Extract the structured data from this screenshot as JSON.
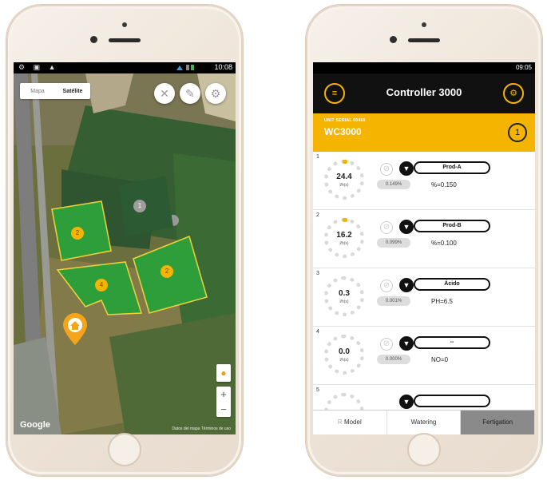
{
  "left_phone": {
    "status": {
      "icons_left": "⚙ ▣ ▲",
      "time": "10:08"
    },
    "map_toggle": {
      "map": "Mapa",
      "satellite": "Satélite"
    },
    "controls": {
      "close_icon": "close-icon",
      "edit_icon": "pencil-icon",
      "settings_icon": "gear-icon"
    },
    "fields": [
      {
        "label": "2",
        "color": "#2e9e3a"
      },
      {
        "label": "4",
        "color": "#2e9e3a"
      },
      {
        "label": "2",
        "color": "#2e9e3a"
      },
      {
        "label": "1",
        "color": "#2c5a32"
      }
    ],
    "home_marker_icon": "home-icon",
    "zoom": {
      "in": "+",
      "out": "−"
    },
    "google_label": "Google",
    "credits": "Datos del mapa   Términos de uso"
  },
  "right_phone": {
    "status": {
      "time": "09:05"
    },
    "header": {
      "title": "Controller 3000",
      "menu_icon": "menu-icon",
      "settings_icon": "gear-icon"
    },
    "unit": {
      "serial_label": "UNIT SERIAL 00466",
      "name": "WC3000",
      "number": "1"
    },
    "channels": [
      {
        "index": "1",
        "value": "24.4",
        "unit": "l/h(s)",
        "product": "Prod-A",
        "percent": "0.149%",
        "param": "%=0.150"
      },
      {
        "index": "2",
        "value": "16.2",
        "unit": "l/h(s)",
        "product": "Prod-B",
        "percent": "0.099%",
        "param": "%=0.100"
      },
      {
        "index": "3",
        "value": "0.3",
        "unit": "l/h(s)",
        "product": "Ácido",
        "percent": "0.001%",
        "param": "PH=6.5"
      },
      {
        "index": "4",
        "value": "0.0",
        "unit": "l/h(s)",
        "product": "--",
        "percent": "0.000%",
        "param": "NO=0"
      },
      {
        "index": "5",
        "value": "",
        "unit": "",
        "product": "",
        "percent": "",
        "param": ""
      }
    ],
    "tabs": [
      "Model",
      "Watering",
      "Fertigation"
    ],
    "active_tab": "Fertigation",
    "model_tab_prefix": "R"
  },
  "colors": {
    "accent": "#f4b400",
    "header_bg": "#111111",
    "field_green": "#2e9e3a",
    "field_border": "#f2d23c"
  }
}
